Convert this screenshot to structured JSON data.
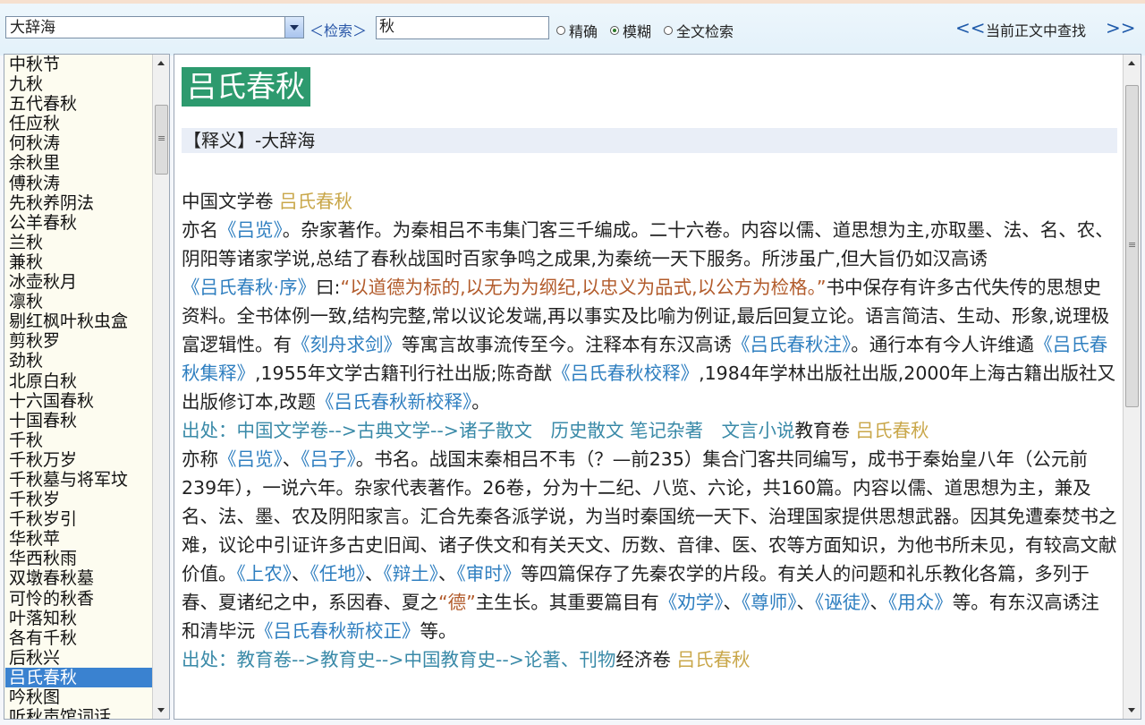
{
  "toolbar": {
    "dictionary": "大辞海",
    "search_label": "＜检索＞",
    "search_value": "秋",
    "modes": [
      "精确",
      "模糊",
      "全文检索"
    ],
    "selected_mode": "模糊",
    "prev": "<<",
    "next": ">>",
    "find_in_text": "当前正文中查找"
  },
  "word_list": [
    "中秋节",
    "九秋",
    "五代春秋",
    "任应秋",
    "何秋涛",
    "余秋里",
    "傅秋涛",
    "先秋养阴法",
    "公羊春秋",
    "兰秋",
    "兼秋",
    "冰壶秋月",
    "凛秋",
    "剔红枫叶秋虫盒",
    "剪秋罗",
    "劲秋",
    "北原白秋",
    "十六国春秋",
    "十国春秋",
    "千秋",
    "千秋万岁",
    "千秋墓与将军坟",
    "千秋岁",
    "千秋岁引",
    "华秋苹",
    "华西秋雨",
    "双墩春秋墓",
    "可怜的秋香",
    "叶落知秋",
    "各有千秋",
    "后秋兴",
    "吕氏春秋",
    "吟秋图",
    "听秋声馆词话"
  ],
  "selected_word": "吕氏春秋",
  "entry": {
    "title": "吕氏春秋",
    "definition_header": "【释义】-大辞海"
  },
  "colors": {
    "title_bg": "#2d9a6e",
    "selected_bg": "#3a82d0",
    "link_blue": "#2f7fc0",
    "gold": "#c9a74a",
    "quote_brown": "#b25b2b"
  }
}
